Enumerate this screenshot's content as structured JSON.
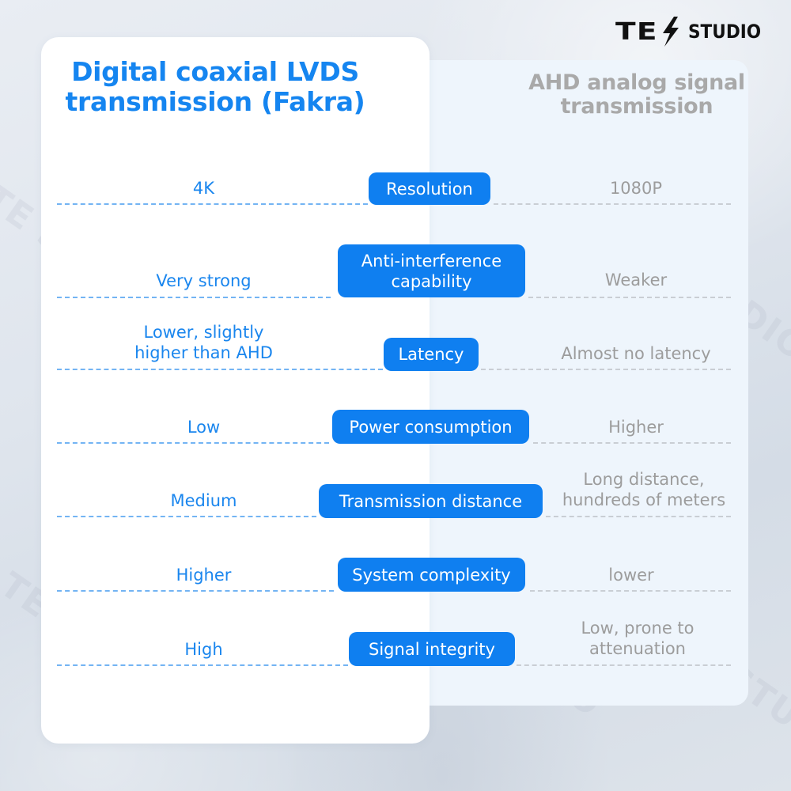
{
  "brand": {
    "logo_mark": "TE",
    "logo_text": "STUDIO",
    "watermark_text": "TE STUDIO",
    "bolt_icon": "lightning-bolt-icon"
  },
  "colors": {
    "accent_blue": "#0f7ff0",
    "left_text_blue": "#1a86ee",
    "right_text_gray": "#9c9c9c",
    "left_card_bg": "#ffffff",
    "right_card_bg": "#eef5fc"
  },
  "comparison": {
    "left_title": "Digital coaxial LVDS transmission (Fakra)",
    "left_title_lines": [
      "Digital coaxial LVDS",
      "transmission (Fakra)"
    ],
    "right_title": "AHD analog signal transmission",
    "right_title_lines": [
      "AHD analog signal",
      "transmission"
    ],
    "rows": [
      {
        "criterion_lines": [
          "Resolution"
        ],
        "left_lines": [
          "4K"
        ],
        "right_lines": [
          "1080P"
        ]
      },
      {
        "criterion_lines": [
          "Anti-interference",
          "capability"
        ],
        "left_lines": [
          "Very strong"
        ],
        "right_lines": [
          "Weaker"
        ]
      },
      {
        "criterion_lines": [
          "Latency"
        ],
        "left_lines": [
          "Lower, slightly",
          "higher than AHD"
        ],
        "right_lines": [
          "Almost no latency"
        ]
      },
      {
        "criterion_lines": [
          "Power consumption"
        ],
        "left_lines": [
          "Low"
        ],
        "right_lines": [
          "Higher"
        ]
      },
      {
        "criterion_lines": [
          "Transmission distance"
        ],
        "left_lines": [
          "Medium"
        ],
        "right_lines": [
          "Long distance,",
          "hundreds of meters"
        ]
      },
      {
        "criterion_lines": [
          "System complexity"
        ],
        "left_lines": [
          "Higher"
        ],
        "right_lines": [
          "lower"
        ]
      },
      {
        "criterion_lines": [
          "Signal integrity"
        ],
        "left_lines": [
          "High"
        ],
        "right_lines": [
          "Low, prone to",
          "attenuation"
        ]
      }
    ]
  }
}
